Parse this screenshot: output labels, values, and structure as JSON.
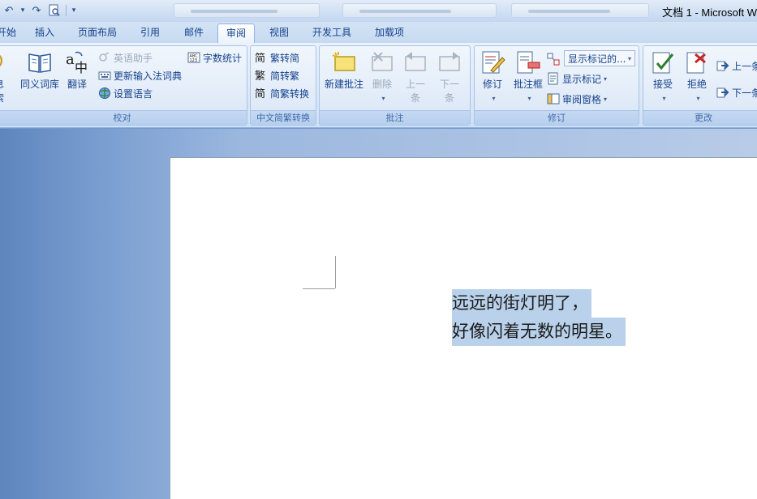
{
  "window": {
    "title": "文档 1 - Microsoft W"
  },
  "quick_access": {
    "undo_icon": "undo-icon",
    "redo_icon": "redo-icon",
    "preview_icon": "print-preview-icon",
    "customize_icon": "customize-qat-icon"
  },
  "tabs": [
    {
      "label": "开始",
      "active": false
    },
    {
      "label": "插入",
      "active": false
    },
    {
      "label": "页面布局",
      "active": false
    },
    {
      "label": "引用",
      "active": false
    },
    {
      "label": "邮件",
      "active": false
    },
    {
      "label": "审阅",
      "active": true
    },
    {
      "label": "视图",
      "active": false
    },
    {
      "label": "开发工具",
      "active": false
    },
    {
      "label": "加载项",
      "active": false
    }
  ],
  "ribbon": {
    "proofing": {
      "label": "校对",
      "research": {
        "line1": "息",
        "line2": "索"
      },
      "thesaurus": "同义词库",
      "translate": "翻译",
      "english_assistant": "英语助手",
      "update_ime": "更新输入法词典",
      "set_language": "设置语言",
      "word_count": "字数统计"
    },
    "chinese_conversion": {
      "label": "中文简繁转换",
      "to_simplified": "繁转简",
      "to_traditional": "简转繁",
      "conversion": "简繁转换"
    },
    "comments": {
      "label": "批注",
      "new_comment": "新建批注",
      "delete": "删除",
      "previous": {
        "line1": "上一",
        "line2": "条"
      },
      "next": {
        "line1": "下一",
        "line2": "条"
      }
    },
    "tracking": {
      "label": "修订",
      "track_changes": "修订",
      "balloons": "批注框",
      "display_for_review": "显示标记的...",
      "show_markup": "显示标记",
      "reviewing_pane": "审阅窗格"
    },
    "changes": {
      "label": "更改",
      "accept": "接受",
      "reject": "拒绝",
      "previous": "上一条",
      "next": "下一条"
    }
  },
  "document": {
    "lines": [
      "远远的街灯明了，",
      "好像闪着无数的明星。"
    ]
  }
}
